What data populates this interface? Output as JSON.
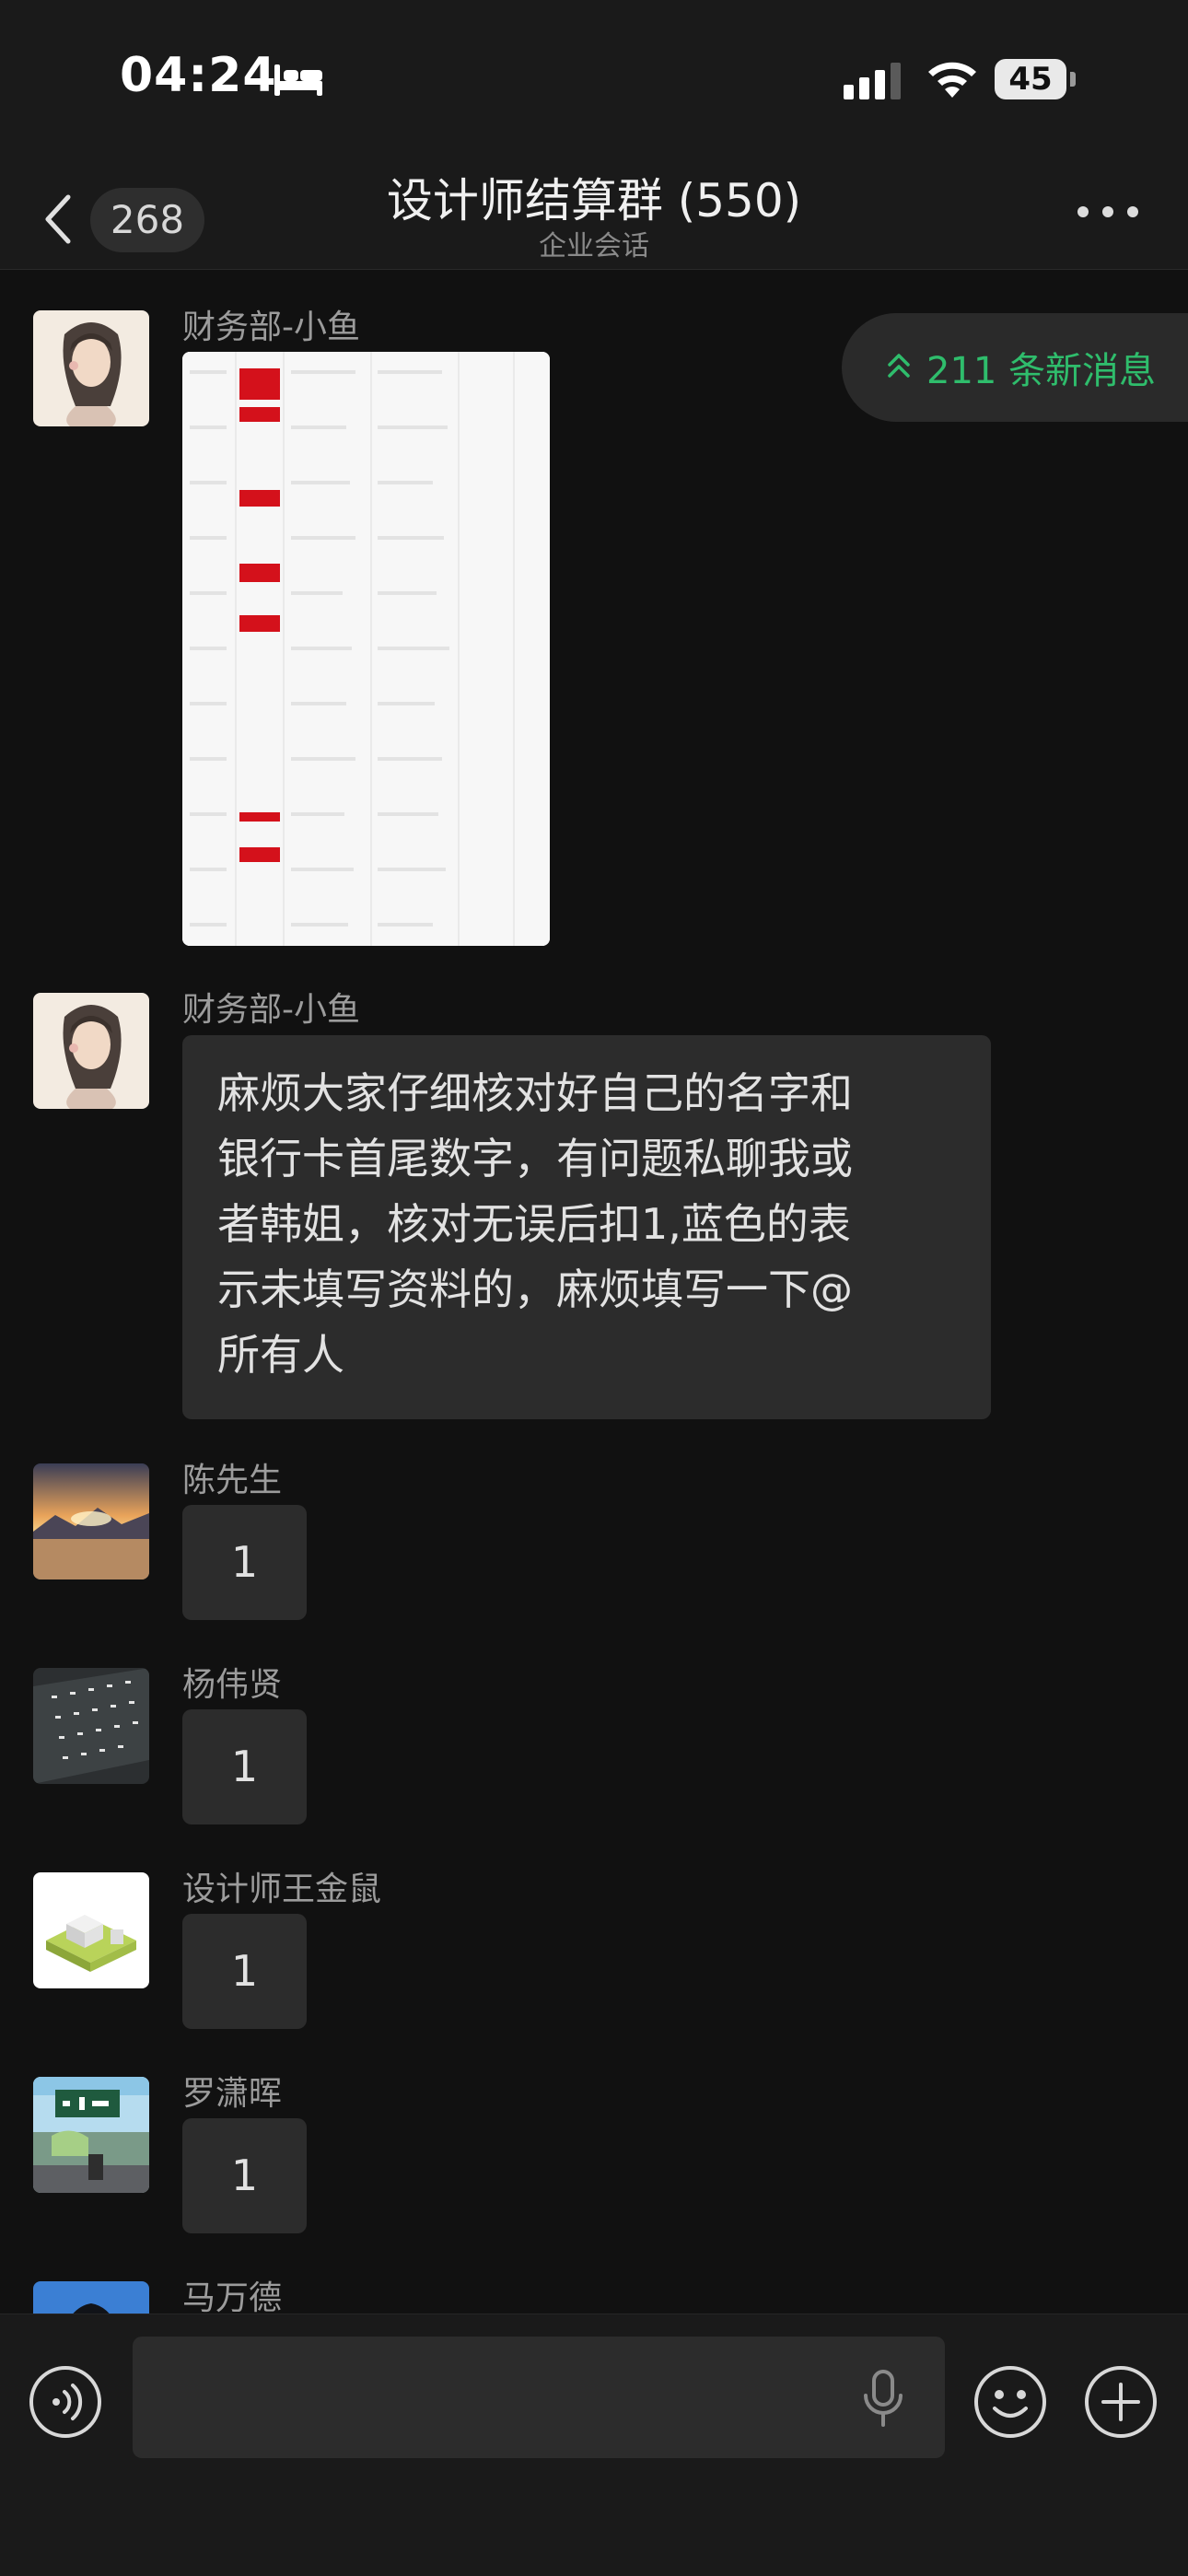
{
  "status_bar": {
    "time": "04:24",
    "battery": "45"
  },
  "nav": {
    "unread_count": "268",
    "title": "设计师结算群 (550)",
    "subtitle": "企业会话"
  },
  "new_messages": {
    "label": "211 条新消息"
  },
  "messages": [
    {
      "sender": "财务部-小鱼",
      "type": "image"
    },
    {
      "sender": "财务部-小鱼",
      "type": "text",
      "lines": [
        "麻烦大家仔细核对好自己的名字和",
        "银行卡首尾数字，有问题私聊我或",
        "者韩姐，核对无误后扣1,蓝色的表",
        "示未填写资料的，麻烦填写一下@",
        "所有人"
      ]
    },
    {
      "sender": "陈先生",
      "text": "1"
    },
    {
      "sender": "杨伟贤",
      "text": "1"
    },
    {
      "sender": "设计师王金鼠",
      "text": "1"
    },
    {
      "sender": "罗潇晖",
      "text": "1"
    },
    {
      "sender": "马万德"
    }
  ],
  "input": {
    "placeholder": ""
  },
  "colors": {
    "background": "#111111",
    "bubble": "#2c2c2c",
    "accent_green": "#2fbd6c"
  },
  "icons": [
    "bed-icon",
    "signal-icon",
    "wifi-icon",
    "back-chevron-icon",
    "more-dots-icon",
    "double-chevron-up-icon",
    "voice-icon",
    "microphone-icon",
    "emoji-icon",
    "plus-icon"
  ]
}
